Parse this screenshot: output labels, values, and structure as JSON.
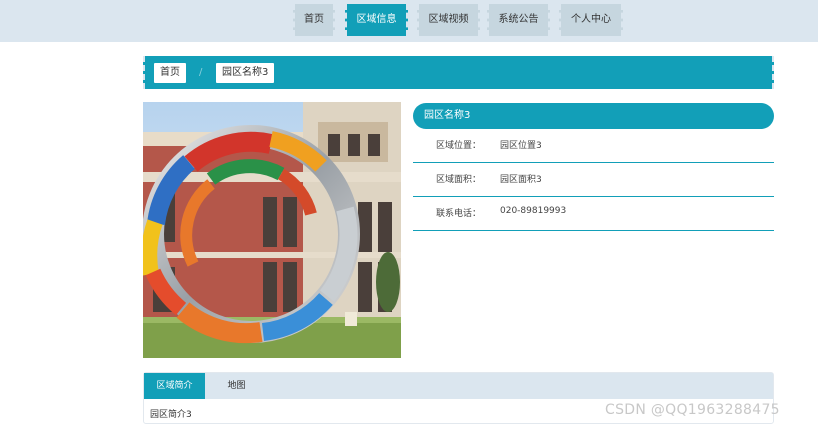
{
  "nav": {
    "items": [
      {
        "label": "首页"
      },
      {
        "label": "区域信息"
      },
      {
        "label": "区域视频"
      },
      {
        "label": "系统公告"
      },
      {
        "label": "个人中心"
      }
    ],
    "active_index": 1
  },
  "breadcrumb": {
    "home": "首页",
    "separator": "/",
    "current": "园区名称3"
  },
  "detail": {
    "title": "园区名称3",
    "rows": [
      {
        "label": "区域位置：",
        "value": "园区位置3"
      },
      {
        "label": "区域面积：",
        "value": "园区面积3"
      },
      {
        "label": "联系电话：",
        "value": "020-89819993"
      }
    ]
  },
  "tabs": {
    "items": [
      {
        "label": "区域简介"
      },
      {
        "label": "地图"
      }
    ],
    "active_index": 0,
    "content": "园区简介3"
  },
  "watermark": "CSDN @QQ1963288475",
  "colors": {
    "accent": "#129fb8",
    "nav_bg": "#dbe6ef",
    "nav_item_bg": "#c6d6df"
  }
}
